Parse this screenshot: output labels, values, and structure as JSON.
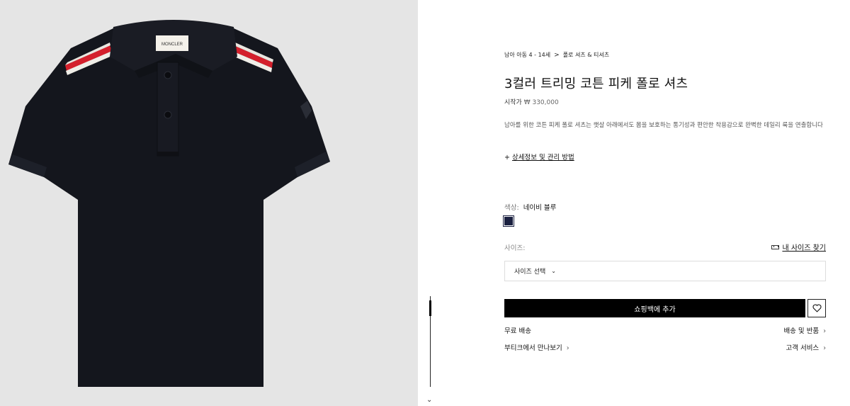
{
  "product_image": {
    "logo_text": "MONCLER"
  },
  "breadcrumb": {
    "items": [
      "남아 아동 4 - 14세",
      "폴로 셔츠 & 티셔츠"
    ],
    "separator": ">"
  },
  "product": {
    "title": "3컬러 트리밍 코튼 피케 폴로 셔츠",
    "price_prefix": "시작가",
    "price": "₩ 330,000",
    "description": "남아를 위한 코튼 피케 폴로 셔츠는 햇살 아래에서도 몸을 보호하는 통기성과 편안한 착용감으로 완벽한 데일리 룩을 연출합니다",
    "details_plus": "+",
    "details_link": "상세정보 및 관리 방법"
  },
  "color": {
    "label": "색상:",
    "value": "네이비 블루",
    "swatch_hex": "#1a2040"
  },
  "size": {
    "label": "사이즈:",
    "guide_label": "내 사이즈 찾기",
    "guide_icon": "ruler-icon",
    "select_label": "사이즈 선택",
    "select_icon": "chevron-down-icon"
  },
  "cart": {
    "add_label": "쇼핑백에 추가",
    "wishlist_icon": "heart-icon"
  },
  "links": {
    "free_shipping": "무료 배송",
    "shipping_returns": "배송 및 반품",
    "boutique": "부티크에서 만나보기",
    "customer_service": "고객 서비스",
    "arrow": "›"
  },
  "scroll": {
    "down_icon": "double-chevron-down-icon",
    "down_glyph": "⌄"
  },
  "colors": {
    "accent": "#000000",
    "swatch": "#1a2040",
    "image_bg": "#e5e5e5"
  }
}
